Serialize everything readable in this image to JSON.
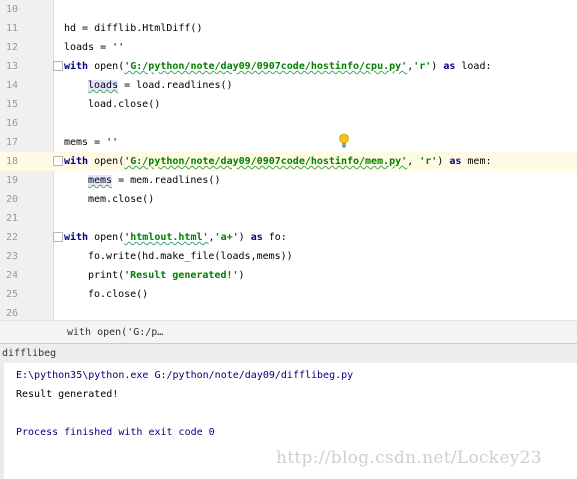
{
  "editor": {
    "line_numbers": [
      "10",
      "11",
      "12",
      "13",
      "14",
      "15",
      "16",
      "17",
      "18",
      "19",
      "20",
      "21",
      "22",
      "23",
      "24",
      "25",
      "26"
    ],
    "line11": {
      "text": "hd = difflib.HtmlDiff()"
    },
    "line12": {
      "pre": "loads = ",
      "str": "''"
    },
    "line13": {
      "kw1": "with",
      "mid1": " open(",
      "str1": "'G:/python/note/day09/0907code/hostinfo/cpu.py'",
      "comma": ",",
      "str2": "'r'",
      "mid2": ") ",
      "kw2": "as",
      "post": " load:"
    },
    "line14": {
      "var": "loads",
      "post": " = load.readlines()"
    },
    "line15": {
      "text": "load.close()"
    },
    "line17": {
      "pre": "mems = ",
      "str": "''"
    },
    "line18": {
      "kw1": "with",
      "mid1": " open(",
      "str1": "'G:/python/note/day09/0907code/hostinfo/mem.py'",
      "comma": ", ",
      "str2": "'r'",
      "mid2": ") ",
      "kw2": "as",
      "post": " mem:"
    },
    "line19": {
      "var": "mems",
      "post": " = mem.readlines()"
    },
    "line20": {
      "text": "mem.close()"
    },
    "line22": {
      "kw1": "with",
      "mid1": " open(",
      "str1": "'htmlout.html'",
      "comma": ",",
      "str2": "'a+'",
      "mid2": ") ",
      "kw2": "as",
      "post": " fo:"
    },
    "line23": {
      "text": "fo.write(hd.make_file(loads,mems))"
    },
    "line24": {
      "pre": "print(",
      "str": "'Result generated!'",
      "post": ")"
    },
    "line25": {
      "text": "fo.close()"
    }
  },
  "breadcrumb": {
    "text": "with open('G:/p…"
  },
  "run_panel": {
    "title": "difflibeg"
  },
  "console": {
    "command": "E:\\python35\\python.exe G:/python/note/day09/difflibeg.py",
    "output": "Result generated!",
    "exit": "Process finished with exit code 0"
  },
  "watermark": "http://blog.csdn.net/Lockey23",
  "icons": {
    "intention": "lightbulb-icon",
    "fold": "fold-marker-icon"
  },
  "colors": {
    "keyword": "#000080",
    "string": "#008000",
    "current_line": "#fffae3",
    "console_cmd": "#000080"
  }
}
